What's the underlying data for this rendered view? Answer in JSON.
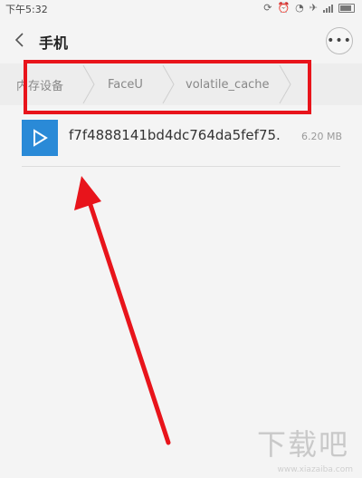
{
  "status_bar": {
    "time": "下午5:32"
  },
  "header": {
    "title": "手机",
    "more_label": "•••"
  },
  "breadcrumb": {
    "items": [
      "内存设备",
      "FaceU",
      "volatile_cache"
    ]
  },
  "files": [
    {
      "name": "f7f4888141bd4dc764da5fef75.",
      "size": "6.20 MB",
      "icon": "video-file-icon"
    }
  ],
  "watermark": {
    "text": "下载吧",
    "url": "www.xiazaiba.com"
  },
  "colors": {
    "highlight": "#e8141b",
    "file_icon": "#2a8ad7",
    "background": "#f4f4f4"
  }
}
